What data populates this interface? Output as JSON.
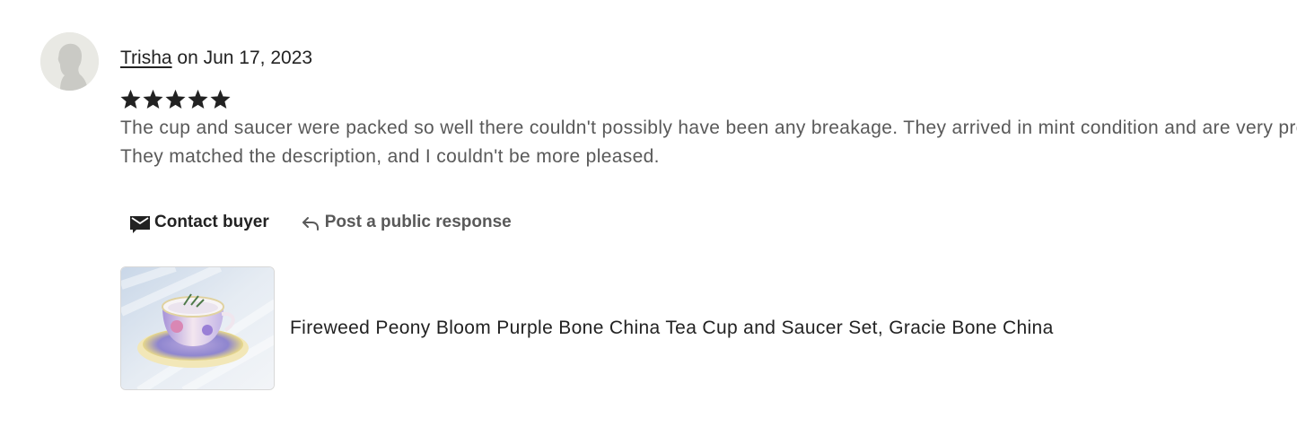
{
  "review": {
    "reviewer_name": "Trisha",
    "date_text": "on Jun 17, 2023",
    "rating": 5,
    "max_rating": 5,
    "text_lines": [
      "The cup and saucer were packed so well there couldn't possibly have been any breakage. They arrived in mint condition and are very pretty.",
      "They matched the description, and I couldn't be more pleased."
    ]
  },
  "actions": {
    "contact_label": "Contact buyer",
    "respond_label": "Post a public response"
  },
  "listing": {
    "title": "Fireweed Peony Bloom Purple Bone China Tea Cup and Saucer Set, Gracie Bone China"
  },
  "icons": {
    "avatar": "default-avatar-icon",
    "star": "star-icon",
    "contact": "envelope-icon",
    "respond": "reply-arrow-icon"
  },
  "colors": {
    "text_primary": "#222222",
    "text_secondary": "#595959",
    "star": "#222222",
    "avatar_bg": "#e9e9e4"
  }
}
